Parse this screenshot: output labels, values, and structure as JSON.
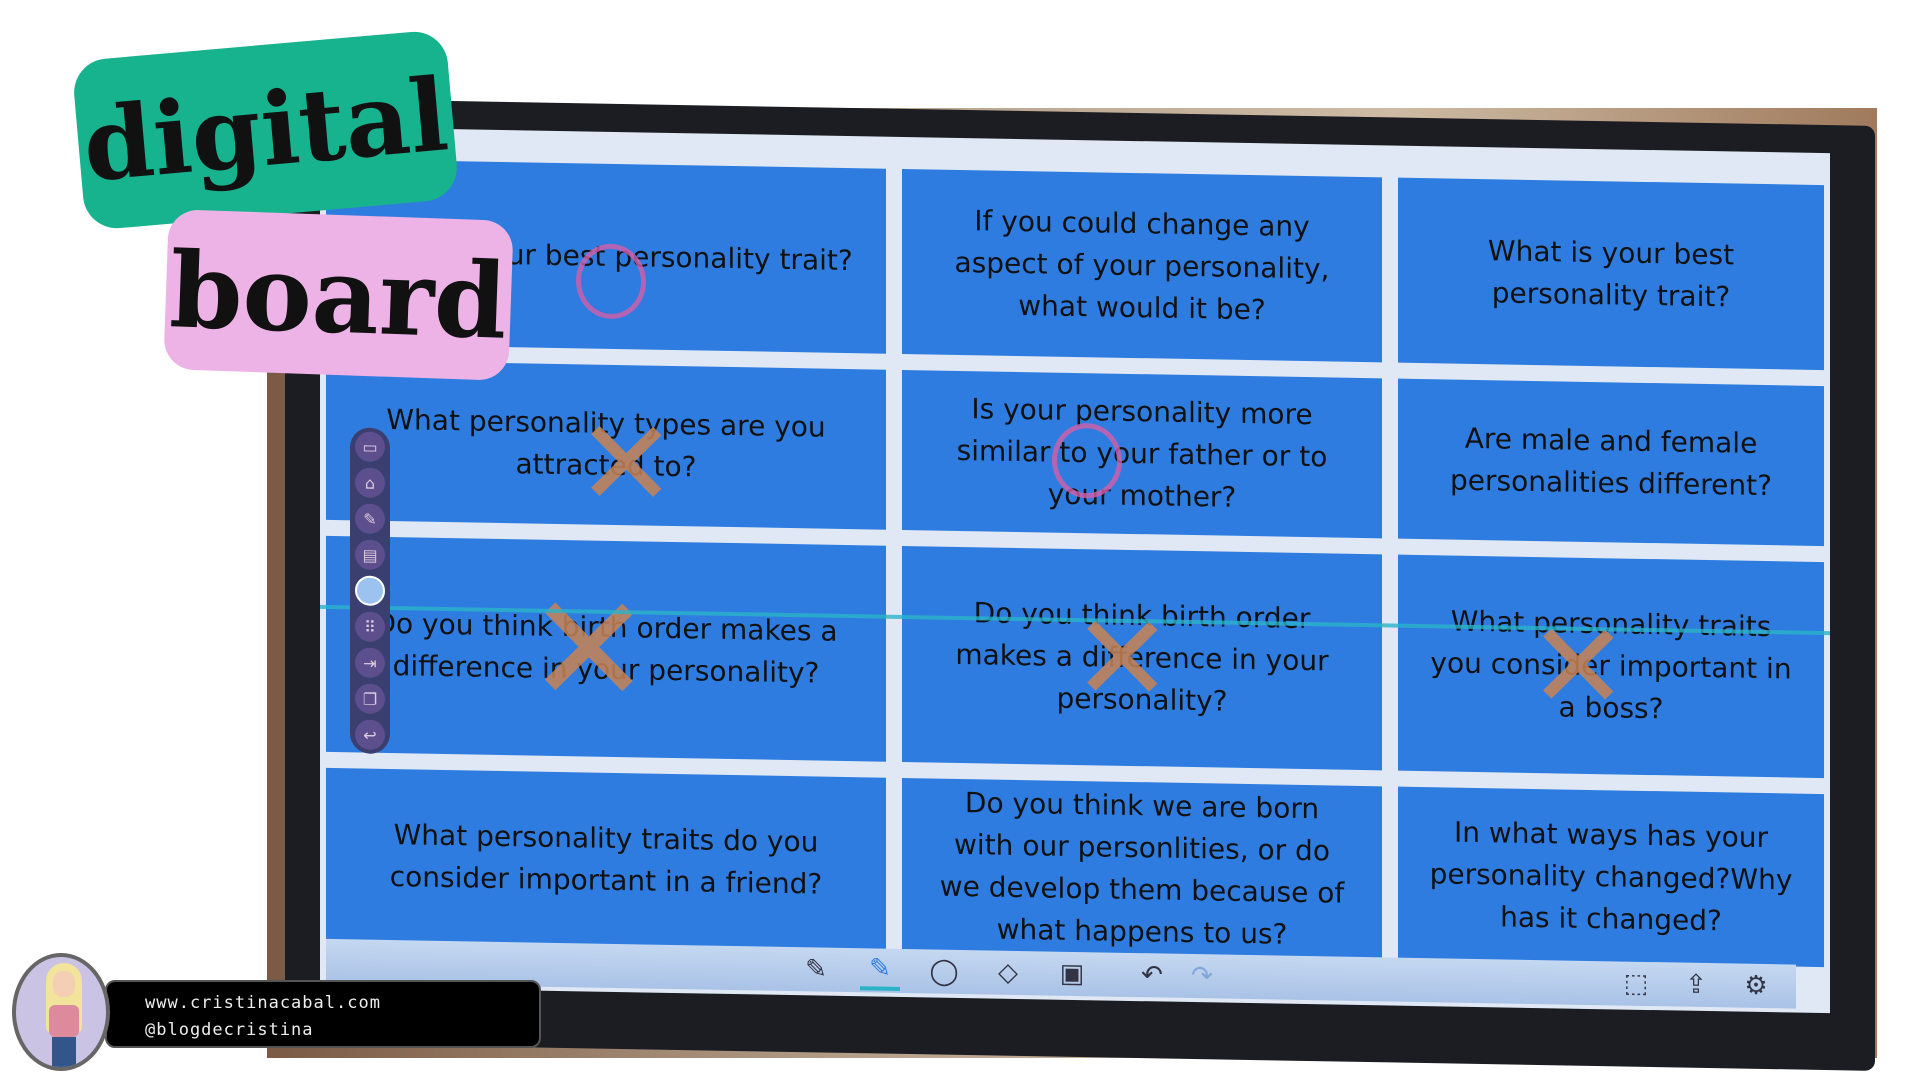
{
  "labels": {
    "digital": "digital",
    "board": "board"
  },
  "cells": [
    "What is your best personality trait?",
    "If you could change any aspect of your personality, what would it be?",
    "What is your best personality trait?",
    "What personality types are you attracted to?",
    "Is your personality more similar to your father or to your mother?",
    "Are male and female personalities different?",
    "Do you think birth order makes a difference in your personality?",
    "Do you think birth order makes a difference in your personality?",
    "What personality traits you consider important in a boss?",
    "What personality traits do you consider important in a friend?",
    "Do you think we are born with our personlities, or do we develop them because of what happens to us?",
    "In what ways has your personality changed?Why has it changed?"
  ],
  "toolbar": {
    "tools": [
      "pen-icon",
      "highlighter-icon",
      "lasso-icon",
      "eraser-icon",
      "whiteboard-icon",
      "undo-icon",
      "redo-icon",
      "screenshot-icon",
      "share-icon",
      "settings-icon"
    ]
  },
  "badge": {
    "website": "www.cristinacabal.com",
    "handle": "@blogdecristina"
  },
  "colors": {
    "cell": "#2f7ce0",
    "green_tag": "#17b28e",
    "pink_tag": "#eeb3e6",
    "highlighter": "#2bb3c8"
  }
}
